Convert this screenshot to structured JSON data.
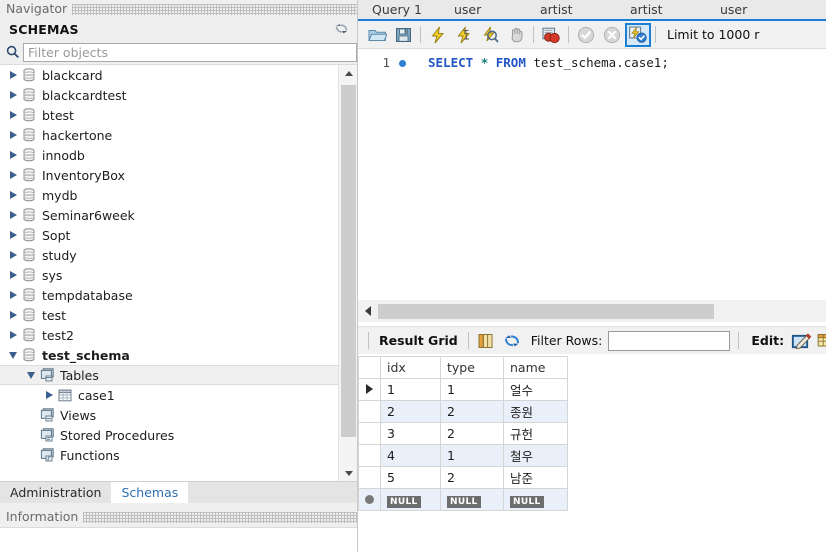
{
  "sidebar": {
    "navigator_caption": "Navigator",
    "schemas_title": "SCHEMAS",
    "refresh_icon": "refresh-icon",
    "search_icon": "search-icon",
    "filter_placeholder": "Filter objects",
    "filter_value": "",
    "tree": [
      {
        "label": "blackcard",
        "icon": "database-icon",
        "state": "collapsed",
        "depth": 0,
        "bold": false,
        "selected": false
      },
      {
        "label": "blackcardtest",
        "icon": "database-icon",
        "state": "collapsed",
        "depth": 0,
        "bold": false,
        "selected": false
      },
      {
        "label": "btest",
        "icon": "database-icon",
        "state": "collapsed",
        "depth": 0,
        "bold": false,
        "selected": false
      },
      {
        "label": "hackertone",
        "icon": "database-icon",
        "state": "collapsed",
        "depth": 0,
        "bold": false,
        "selected": false
      },
      {
        "label": "innodb",
        "icon": "database-icon",
        "state": "collapsed",
        "depth": 0,
        "bold": false,
        "selected": false
      },
      {
        "label": "InventoryBox",
        "icon": "database-icon",
        "state": "collapsed",
        "depth": 0,
        "bold": false,
        "selected": false
      },
      {
        "label": "mydb",
        "icon": "database-icon",
        "state": "collapsed",
        "depth": 0,
        "bold": false,
        "selected": false
      },
      {
        "label": "Seminar6week",
        "icon": "database-icon",
        "state": "collapsed",
        "depth": 0,
        "bold": false,
        "selected": false
      },
      {
        "label": "Sopt",
        "icon": "database-icon",
        "state": "collapsed",
        "depth": 0,
        "bold": false,
        "selected": false
      },
      {
        "label": "study",
        "icon": "database-icon",
        "state": "collapsed",
        "depth": 0,
        "bold": false,
        "selected": false
      },
      {
        "label": "sys",
        "icon": "database-icon",
        "state": "collapsed",
        "depth": 0,
        "bold": false,
        "selected": false
      },
      {
        "label": "tempdatabase",
        "icon": "database-icon",
        "state": "collapsed",
        "depth": 0,
        "bold": false,
        "selected": false
      },
      {
        "label": "test",
        "icon": "database-icon",
        "state": "collapsed",
        "depth": 0,
        "bold": false,
        "selected": false
      },
      {
        "label": "test2",
        "icon": "database-icon",
        "state": "collapsed",
        "depth": 0,
        "bold": false,
        "selected": false
      },
      {
        "label": "test_schema",
        "icon": "database-icon",
        "state": "expanded",
        "depth": 0,
        "bold": true,
        "selected": false
      },
      {
        "label": "Tables",
        "icon": "folder-tables-icon",
        "state": "expanded",
        "depth": 1,
        "bold": false,
        "selected": true
      },
      {
        "label": "case1",
        "icon": "table-icon",
        "state": "collapsed",
        "depth": 2,
        "bold": false,
        "selected": false
      },
      {
        "label": "Views",
        "icon": "folder-views-icon",
        "state": "none",
        "depth": 1,
        "bold": false,
        "selected": false
      },
      {
        "label": "Stored Procedures",
        "icon": "folder-procedures-icon",
        "state": "none",
        "depth": 1,
        "bold": false,
        "selected": false
      },
      {
        "label": "Functions",
        "icon": "folder-functions-icon",
        "state": "none",
        "depth": 1,
        "bold": false,
        "selected": false
      }
    ],
    "tabs": [
      {
        "label": "Administration",
        "active": false
      },
      {
        "label": "Schemas",
        "active": true
      }
    ],
    "information_caption": "Information"
  },
  "editor": {
    "tabs": [
      {
        "label": "Query 1",
        "active": true
      },
      {
        "label": "user",
        "active": false
      },
      {
        "label": "artist",
        "active": false
      },
      {
        "label": "artist",
        "active": false
      },
      {
        "label": "user",
        "active": false
      }
    ],
    "toolbar": [
      {
        "name": "open-sql-script-icon",
        "selected": false
      },
      {
        "name": "save-sql-script-icon",
        "selected": false
      },
      {
        "name": "execute-statement-icon",
        "selected": false
      },
      {
        "name": "execute-current-statement-icon",
        "selected": false
      },
      {
        "name": "explain-query-icon",
        "selected": false
      },
      {
        "name": "stop-execution-icon",
        "selected": false
      },
      {
        "name": "toggle-stop-on-error-icon",
        "selected": false
      },
      {
        "name": "commit-icon",
        "selected": false
      },
      {
        "name": "rollback-icon",
        "selected": false
      },
      {
        "name": "toggle-autocommit-icon",
        "selected": true
      }
    ],
    "limit_label": "Limit to 1000 r",
    "line_number": "1",
    "sql": {
      "kw1": "SELECT",
      "star": "*",
      "kw2": "FROM",
      "table": "test_schema.case1",
      "semicolon": ";"
    }
  },
  "results": {
    "result_grid_label": "Result Grid",
    "grid_view_icon": "grid-view-icon",
    "refresh-results-icon": "refresh-results-icon",
    "filter_rows_label": "Filter Rows:",
    "filter_rows_value": "",
    "filter_rows_placeholder": "",
    "edit_label": "Edit:",
    "edit_icons": [
      {
        "name": "edit-row-icon"
      },
      {
        "name": "insert-row-icon"
      }
    ],
    "columns": [
      "idx",
      "type",
      "name"
    ],
    "rows": [
      {
        "cells": [
          "1",
          "1",
          "얼수"
        ],
        "current": true
      },
      {
        "cells": [
          "2",
          "2",
          "종원"
        ],
        "current": false
      },
      {
        "cells": [
          "3",
          "2",
          "규헌"
        ],
        "current": false
      },
      {
        "cells": [
          "4",
          "1",
          "철우"
        ],
        "current": false
      },
      {
        "cells": [
          "5",
          "2",
          "남준"
        ],
        "current": false
      }
    ],
    "new_row": {
      "cells": [
        "NULL",
        "NULL",
        "NULL"
      ]
    }
  },
  "colors": {
    "accent": "#1c7fd6",
    "keyword": "#2255c6",
    "operator": "#1e7f7f",
    "alt_row": "#eaf0f9",
    "toolbar_bg": "#f1f1f1",
    "sidebar_bg": "#efefef"
  }
}
